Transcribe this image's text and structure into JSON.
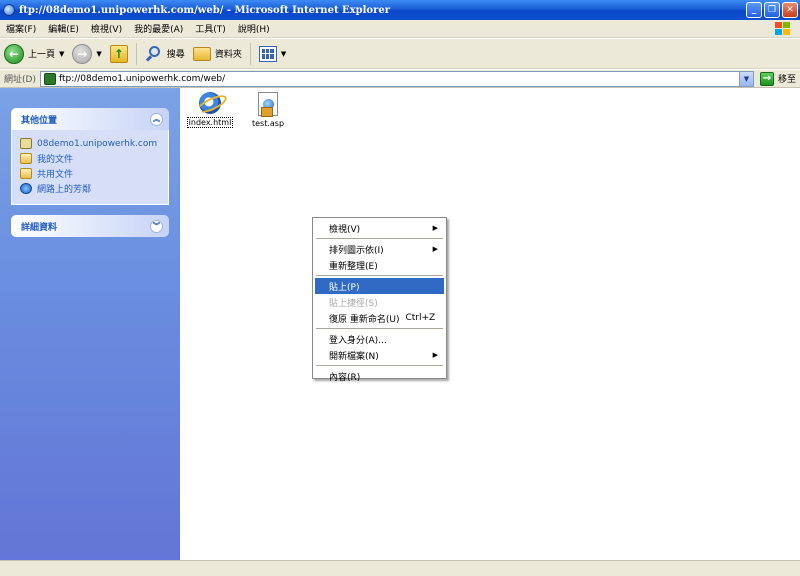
{
  "window": {
    "title": "ftp://08demo1.unipowerhk.com/web/ - Microsoft Internet Explorer"
  },
  "menubar": [
    "檔案(F)",
    "編輯(E)",
    "檢視(V)",
    "我的最愛(A)",
    "工具(T)",
    "說明(H)"
  ],
  "toolbar": {
    "back": "上一頁",
    "search": "搜尋",
    "folders": "資料夾"
  },
  "address": {
    "label": "網址(D)",
    "value": "ftp://08demo1.unipowerhk.com/web/",
    "go": "移至"
  },
  "other_places": {
    "title": "其他位置",
    "links": [
      "08demo1.unipowerhk.com",
      "我的文件",
      "共用文件",
      "網路上的芳鄰"
    ]
  },
  "details": {
    "title": "詳細資料"
  },
  "files": [
    {
      "name": "index.html",
      "icon": "ie-html-file-icon"
    },
    {
      "name": "test.asp",
      "icon": "asp-file-icon"
    }
  ],
  "context_menu": {
    "view": "檢視(V)",
    "arrange": "排列圖示依(I)",
    "refresh": "重新整理(E)",
    "paste": "貼上(P)",
    "paste_shortcut": "貼上捷徑(S)",
    "undo": "復原 重新命名(U)",
    "undo_shortcut": "Ctrl+Z",
    "login": "登入身分(A)...",
    "new": "開新檔案(N)",
    "properties": "內容(R)"
  },
  "colors": {
    "highlight": "#316ac5",
    "taskpane_link": "#215dc6"
  }
}
